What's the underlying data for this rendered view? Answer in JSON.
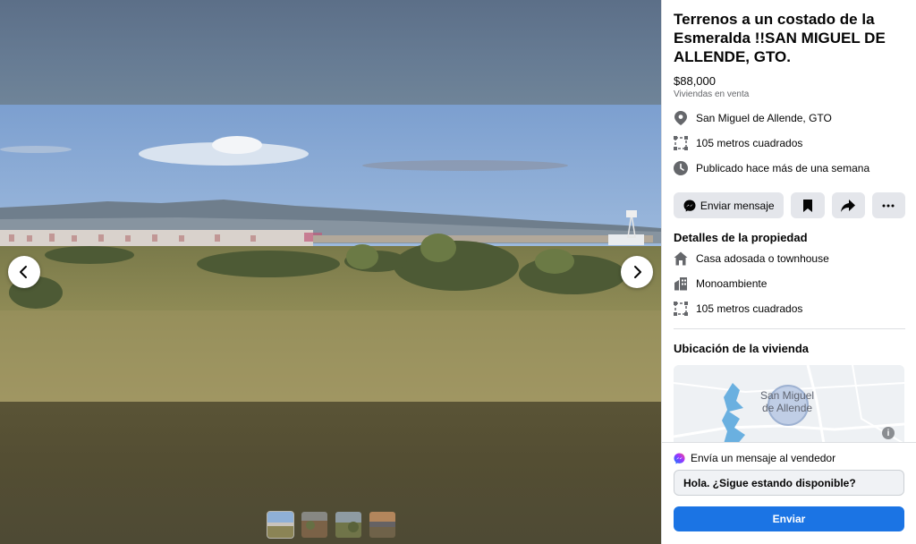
{
  "listing": {
    "title": "Terrenos a un costado de la Esmeralda !!SAN MIGUEL DE ALLENDE, GTO.",
    "price": "$88,000",
    "category": "Viviendas en venta",
    "info": [
      {
        "icon": "location-pin-icon",
        "text": "San Miguel de Allende, GTO"
      },
      {
        "icon": "area-icon",
        "text": "105 metros cuadrados"
      },
      {
        "icon": "clock-icon",
        "text": "Publicado hace más de una semana"
      }
    ]
  },
  "actions": {
    "message_label": "Enviar mensaje"
  },
  "details": {
    "title": "Detalles de la propiedad",
    "items": [
      {
        "icon": "house-icon",
        "text": "Casa adosada o townhouse"
      },
      {
        "icon": "building-icon",
        "text": "Monoambiente"
      },
      {
        "icon": "area-icon",
        "text": "105 metros cuadrados"
      }
    ]
  },
  "location": {
    "title": "Ubicación de la vivienda",
    "map_label_line1": "San Miguel",
    "map_label_line2": "de Allende",
    "info_glyph": "i"
  },
  "seller": {
    "heading": "Envía un mensaje al vendedor",
    "message_value": "Hola. ¿Sigue estando disponible?",
    "send_label": "Enviar"
  },
  "gallery": {
    "thumbnail_count": 4,
    "active_index": 0
  },
  "colors": {
    "accent": "#1b74e4",
    "button_gray": "#e4e6eb",
    "messenger": "#a33bff"
  }
}
